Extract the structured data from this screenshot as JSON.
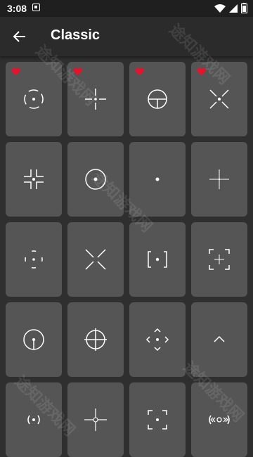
{
  "status": {
    "time": "3:08"
  },
  "app_bar": {
    "title": "Classic"
  },
  "watermark": "途知游戏网",
  "crosshairs": [
    {
      "icon": "dashed-circle-dot",
      "favorite": true
    },
    {
      "icon": "cross-dot",
      "favorite": true
    },
    {
      "icon": "circle-t",
      "favorite": true
    },
    {
      "icon": "x-dot",
      "favorite": true
    },
    {
      "icon": "corner-brackets-dot",
      "favorite": false
    },
    {
      "icon": "circle-dot",
      "favorite": false
    },
    {
      "icon": "dot",
      "favorite": false
    },
    {
      "icon": "thin-cross",
      "favorite": false
    },
    {
      "icon": "arc-dashes-dot",
      "favorite": false
    },
    {
      "icon": "x-open",
      "favorite": false
    },
    {
      "icon": "brackets-dot",
      "favorite": false
    },
    {
      "icon": "square-corners-cross",
      "favorite": false
    },
    {
      "icon": "circle-line",
      "favorite": false
    },
    {
      "icon": "circle-cross",
      "favorite": false
    },
    {
      "icon": "diamond-arrows-dot",
      "favorite": false
    },
    {
      "icon": "chevron-up",
      "favorite": false
    },
    {
      "icon": "parens-dot",
      "favorite": false
    },
    {
      "icon": "cross-small-circle",
      "favorite": false
    },
    {
      "icon": "corner-marks-dot",
      "favorite": false
    },
    {
      "icon": "arrows-circle",
      "favorite": false
    }
  ],
  "colors": {
    "tile": "#555555",
    "heart": "#e8112b",
    "background": "#2f2f2f"
  }
}
